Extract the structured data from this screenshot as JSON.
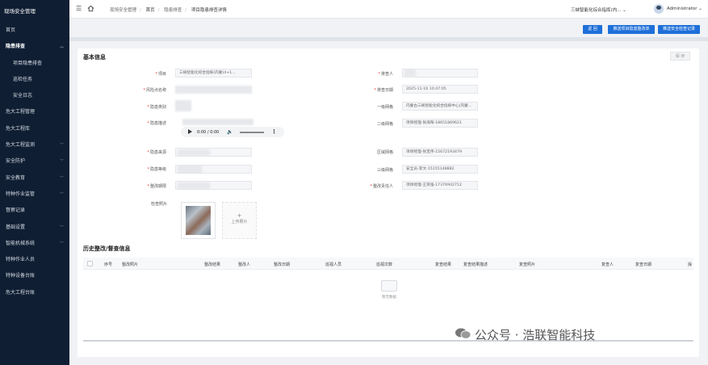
{
  "sidebar": {
    "title": "现场安全管理",
    "items": [
      {
        "label": "首页",
        "level": 1,
        "active": false,
        "expandable": false
      },
      {
        "label": "隐患排查",
        "level": 1,
        "active": true,
        "expandable": true
      },
      {
        "label": "项目隐患排查",
        "level": 2
      },
      {
        "label": "巡检任务",
        "level": 2
      },
      {
        "label": "安全日志",
        "level": 2
      },
      {
        "label": "危大工程管理",
        "level": 1,
        "expandable": false
      },
      {
        "label": "危大工程库",
        "level": 1,
        "expandable": false
      },
      {
        "label": "危大工程监测",
        "level": 1,
        "expandable": true
      },
      {
        "label": "安全防护",
        "level": 1,
        "expandable": true
      },
      {
        "label": "安全教育",
        "level": 1,
        "expandable": true
      },
      {
        "label": "特种作业监管",
        "level": 1,
        "expandable": true
      },
      {
        "label": "督察记录",
        "level": 1,
        "expandable": false
      },
      {
        "label": "基础设置",
        "level": 1,
        "expandable": true
      },
      {
        "label": "智能机械系统",
        "level": 1,
        "expandable": true
      },
      {
        "label": "特种作业人员",
        "level": 1,
        "expandable": false
      },
      {
        "label": "特种设备台账",
        "level": 1,
        "expandable": false
      },
      {
        "label": "危大工程台账",
        "level": 1,
        "expandable": false
      }
    ]
  },
  "topbar": {
    "breadcrumbs": [
      "现场安全管理",
      "首页",
      "隐患排查",
      "项目隐患排查详情"
    ],
    "company": "三峡智能化综合指挥(内...",
    "user": "Administrator"
  },
  "toolbar": {
    "back": "返 回",
    "push_project": "推送项目隐患整改单",
    "push_safety": "推送安全检查记录"
  },
  "basic": {
    "title": "基本信息",
    "edit": "保 存",
    "fields": {
      "project_label": "项目",
      "project_value": "三峡智能化综合指挥(内蒙)4+1...",
      "area_label": "风险点名称",
      "category_label": "隐患类别",
      "description_label": "隐患描述",
      "reporter_label": "排查人",
      "check_date_label": "排查日期",
      "check_date_value": "2025-11-16 10:47:05",
      "level1_label": "一级网格",
      "level1_value": "内蒙古三峡智能化综合指挥中心(内蒙...",
      "level2_label": "二级网格",
      "level2_value": "项目经理-张海晖-18651869621",
      "source_label": "隐患来源",
      "level_label": "隐患等级",
      "deadline_label": "整改期限",
      "grid_leader_label": "区域网格",
      "grid_leader_value": "项目经理-张宝伟-15672193479",
      "level3_label": "三级网格",
      "level3_value": "安全员-李文-15155148882",
      "rectifier_label": "整改责任人",
      "rectifier_value": "项目经理-王宾强-17376942712",
      "photos_label": "检查照片",
      "upload_label": "上传照片"
    },
    "audio": {
      "time": "0:00 / 0:00"
    }
  },
  "history": {
    "title": "历史整改/督查信息",
    "columns": [
      "序号",
      "整改照片",
      "整改结果",
      "整改人",
      "整改日期",
      "巡视人员",
      "巡视次数",
      "复查结果",
      "复查结果描述",
      "复查照片",
      "复查人",
      "复查日期",
      "操"
    ],
    "empty_text": "暂无数据"
  },
  "watermark": "公众号 · 浩联智能科技"
}
